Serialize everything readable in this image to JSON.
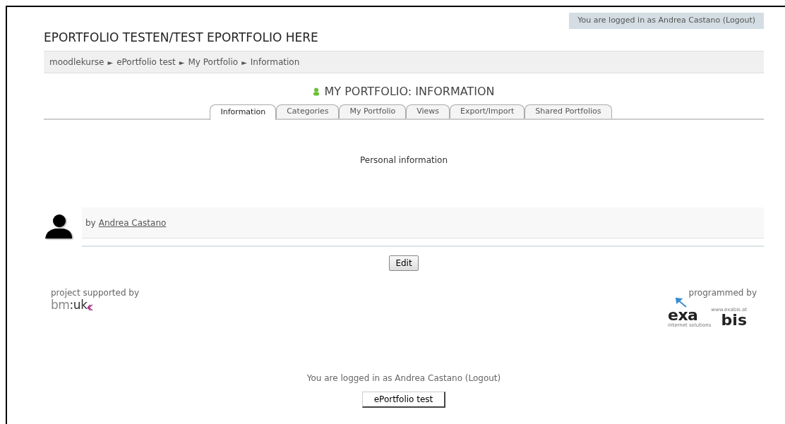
{
  "login_top": "You are logged in as Andrea Castano (Logout)",
  "site_title": "EPORTFOLIO TESTEN/TEST EPORTFOLIO HERE",
  "breadcrumb": {
    "separator": "►",
    "items": [
      "moodlekurse",
      "ePortfolio test",
      "My Portfolio",
      "Information"
    ]
  },
  "page_heading": "MY PORTFOLIO: INFORMATION",
  "tabs": [
    {
      "label": "Information",
      "selected": true
    },
    {
      "label": "Categories",
      "selected": false
    },
    {
      "label": "My Portfolio",
      "selected": false
    },
    {
      "label": "Views",
      "selected": false
    },
    {
      "label": "Export/Import",
      "selected": false
    },
    {
      "label": "Shared Portfolios",
      "selected": false
    }
  ],
  "section_title": "Personal information",
  "author": {
    "prefix": "by",
    "name": "Andrea Castano"
  },
  "edit_button": "Edit",
  "supported": {
    "label": "project supported by",
    "logo_a": "bm",
    "logo_b": ":uk"
  },
  "programmed": {
    "label": "programmed by",
    "logo_ex": "exa",
    "logo_bis": "bis",
    "logo_url": "www.exabis.at",
    "logo_sub": "internet solutions"
  },
  "login_bottom": "You are logged in as Andrea Castano (Logout)",
  "course_button": "ePortfolio test"
}
